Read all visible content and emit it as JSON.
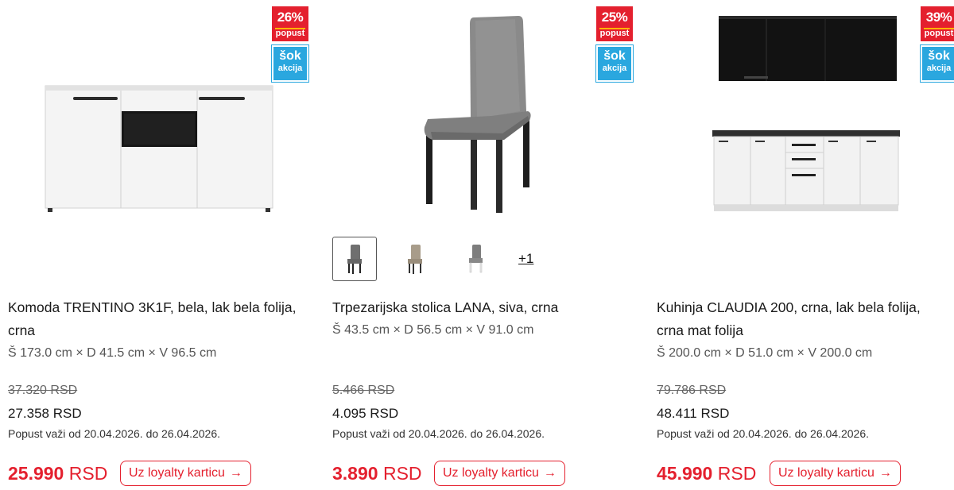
{
  "products": [
    {
      "title": "Komoda TRENTINO 3K1F, bela, lak bela folija, crna",
      "dimensions": "Š 173.0 cm × D 41.5 cm × V 96.5 cm",
      "old_price": "37.320 RSD",
      "price": "27.358 RSD",
      "validity": "Popust važi od 20.04.2026. do 26.04.2026.",
      "loyalty_amount": "25.990",
      "loyalty_currency": "RSD",
      "loyalty_button": "Uz loyalty karticu",
      "discount_pct": "26%",
      "discount_label": "popust",
      "sok_line1": "šok",
      "sok_line2": "akcija",
      "image_icon": "sideboard-image"
    },
    {
      "title": "Trpezarijska stolica LANA, siva, crna",
      "dimensions": "Š 43.5 cm × D 56.5 cm × V 91.0 cm",
      "old_price": "5.466 RSD",
      "price": "4.095 RSD",
      "validity": "Popust važi od 20.04.2026. do 26.04.2026.",
      "loyalty_amount": "3.890",
      "loyalty_currency": "RSD",
      "loyalty_button": "Uz loyalty karticu",
      "discount_pct": "25%",
      "discount_label": "popust",
      "sok_line1": "šok",
      "sok_line2": "akcija",
      "image_icon": "chair-image",
      "variants": [
        {
          "color": "#6f6f6f",
          "active": true
        },
        {
          "color": "#a89c8a",
          "active": false
        },
        {
          "color": "#7d7d7d",
          "active": false
        }
      ],
      "more_variants": "+1"
    },
    {
      "title": "Kuhinja CLAUDIA 200, crna, lak bela folija, crna mat folija",
      "dimensions": "Š 200.0 cm × D 51.0 cm × V 200.0 cm",
      "old_price": "79.786 RSD",
      "price": "48.411 RSD",
      "validity": "Popust važi od 20.04.2026. do 26.04.2026.",
      "loyalty_amount": "45.990",
      "loyalty_currency": "RSD",
      "loyalty_button": "Uz loyalty karticu",
      "discount_pct": "39%",
      "discount_label": "popust",
      "sok_line1": "šok",
      "sok_line2": "akcija",
      "image_icon": "kitchen-image"
    }
  ],
  "colors": {
    "accent_red": "#e4202e",
    "sok_blue": "#2aa7df"
  }
}
